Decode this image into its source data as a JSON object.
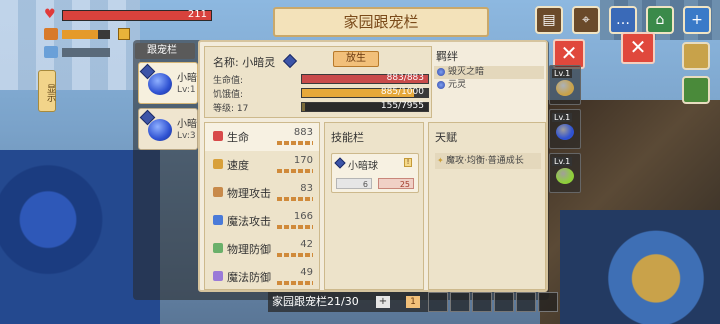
{
  "hud": {
    "hp_text": "211",
    "hp_ratio": 1.0,
    "hunger_ratio": 0.75,
    "side_button": "显示"
  },
  "panel": {
    "title": "家园跟宠栏",
    "tab_label": "跟宠栏",
    "close": "✕"
  },
  "pet_list": [
    {
      "name": "小暗",
      "level": "Lv:1"
    },
    {
      "name": "小暗",
      "level": "Lv:3"
    }
  ],
  "pet": {
    "name_label": "名称:",
    "name": "小暗灵",
    "release_button": "放生",
    "hp_label": "生命值:",
    "hp_value": "883/883",
    "hp_ratio": 1.0,
    "hunger_label": "饥饿值:",
    "hunger_value": "885/1000",
    "hunger_ratio": 0.885,
    "level_label": "等级:",
    "level": "17",
    "exp_value": "155/7955",
    "exp_ratio": 0.02
  },
  "bond": {
    "title": "羁绊",
    "items": [
      "毁灭之暗",
      "元灵"
    ]
  },
  "attributes": [
    {
      "label": "生命",
      "value": "883",
      "icon_color": "#d84a4a"
    },
    {
      "label": "速度",
      "value": "170",
      "icon_color": "#d8a03a"
    },
    {
      "label": "物理攻击",
      "value": "83",
      "icon_color": "#c88a4a"
    },
    {
      "label": "魔法攻击",
      "value": "166",
      "icon_color": "#4a7ad8"
    },
    {
      "label": "物理防御",
      "value": "42",
      "icon_color": "#6ab06a"
    },
    {
      "label": "魔法防御",
      "value": "49",
      "icon_color": "#9a7ad8"
    }
  ],
  "skills": {
    "title": "技能栏",
    "items": [
      {
        "name": "小暗球",
        "cost_a": "6",
        "cost_b": "25"
      }
    ]
  },
  "talent": {
    "title": "天赋",
    "items": [
      "魔攻·均衡·普通成长"
    ]
  },
  "right_slots": [
    {
      "tag": "Lv.1",
      "color": "#c9a24a"
    },
    {
      "tag": "Lv.1",
      "color": "#2f52d2"
    },
    {
      "tag": "Lv.1",
      "color": "#8fcf3a"
    }
  ],
  "bottom": {
    "label": "家园跟宠栏21/30",
    "plus": "+",
    "count": "1"
  },
  "top_icons": [
    "backpack-icon",
    "map-icon",
    "chat-icon",
    "shop-icon",
    "add-icon"
  ]
}
